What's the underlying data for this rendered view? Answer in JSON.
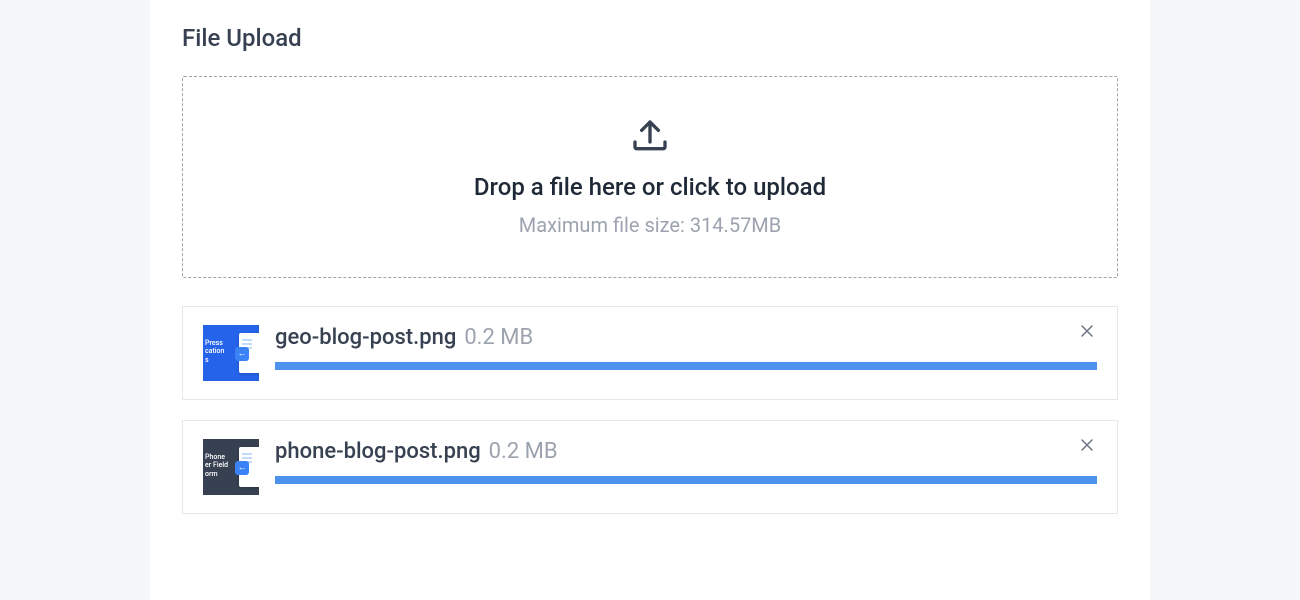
{
  "title": "File Upload",
  "dropzone": {
    "primary": "Drop a file here or click to upload",
    "hint": "Maximum file size: 314.57MB"
  },
  "files": [
    {
      "name": "geo-blog-post.png",
      "size": "0.2 MB",
      "progress": 100,
      "thumb_caption": "Press\ncation\ns",
      "thumb_style": "blue"
    },
    {
      "name": "phone-blog-post.png",
      "size": "0.2 MB",
      "progress": 100,
      "thumb_caption": "Phone\ner Field\norm",
      "thumb_style": "dark"
    }
  ]
}
